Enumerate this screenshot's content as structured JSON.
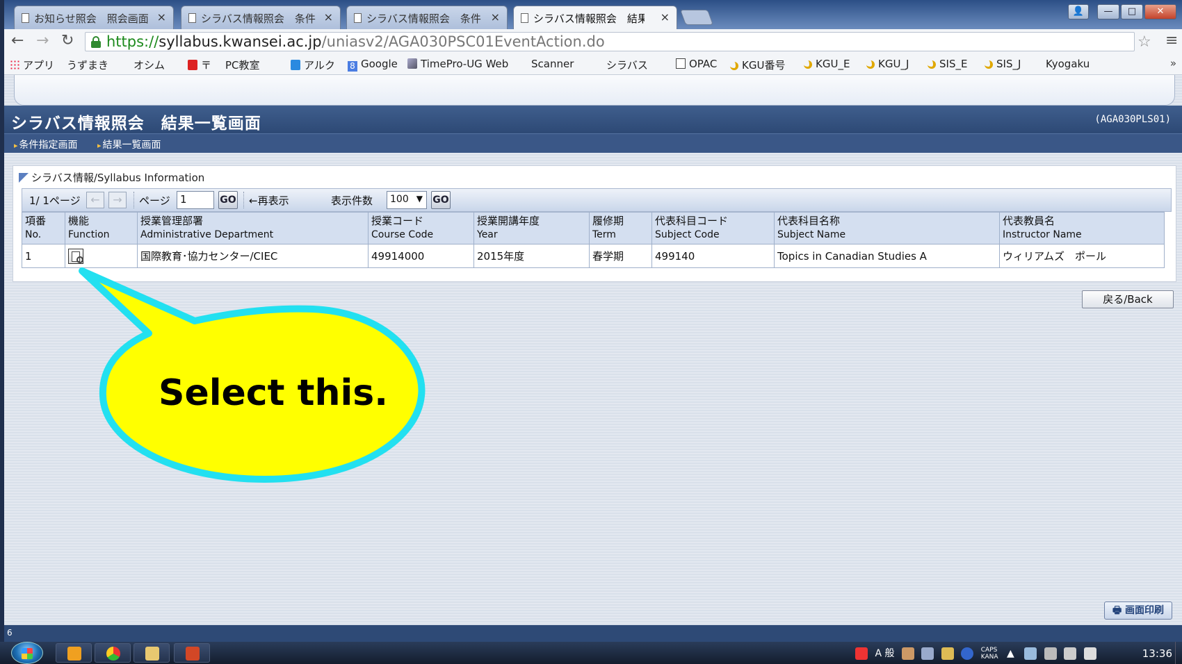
{
  "browser": {
    "tabs": [
      {
        "label": "お知らせ照会　照会画面"
      },
      {
        "label": "シラバス情報照会　条件"
      },
      {
        "label": "シラバス情報照会　条件"
      },
      {
        "label": "シラバス情報照会　結果"
      }
    ],
    "url": {
      "scheme": "https://",
      "host": "syllabus.kwansei.ac.jp",
      "path": "/uniasv2/AGA030PSC01EventAction.do"
    },
    "bookmarks": [
      {
        "label": "アプリ",
        "icon": "apps-grid-icon"
      },
      {
        "label": "うずまき",
        "icon": "page-icon"
      },
      {
        "label": "オシム",
        "icon": "page-icon"
      },
      {
        "label": "〒",
        "icon": "japan-post-icon"
      },
      {
        "label": "PC教室",
        "icon": "page-icon"
      },
      {
        "label": "アルク",
        "icon": "alc-icon"
      },
      {
        "label": "Google",
        "icon": "google-icon"
      },
      {
        "label": "TimePro-UG Web",
        "icon": "timepro-icon"
      },
      {
        "label": "Scanner",
        "icon": "page-icon"
      },
      {
        "label": "シラバス",
        "icon": "page-icon"
      },
      {
        "label": "OPAC",
        "icon": "opac-icon"
      },
      {
        "label": "KGU番号",
        "icon": "moon-icon"
      },
      {
        "label": "KGU_E",
        "icon": "moon-icon"
      },
      {
        "label": "KGU_J",
        "icon": "moon-icon"
      },
      {
        "label": "SIS_E",
        "icon": "moon-icon"
      },
      {
        "label": "SIS_J",
        "icon": "moon-icon"
      },
      {
        "label": "Kyogaku",
        "icon": "page-icon"
      }
    ],
    "more_label": "»"
  },
  "page": {
    "title": "シラバス情報照会　結果一覧画面",
    "screen_id": "(AGA030PLS01)",
    "breadcrumbs": [
      {
        "label": "条件指定画面"
      },
      {
        "label": "結果一覧画面"
      }
    ],
    "section_title": "シラバス情報/Syllabus Information",
    "pager": {
      "page_info": "1/ 1ページ",
      "page_label": "ページ",
      "page_value": "1",
      "go_label": "GO",
      "redisplay_label": "←再表示",
      "count_label": "表示件数",
      "count_value": "100",
      "go2_label": "GO"
    },
    "table": {
      "columns": [
        {
          "ja": "項番",
          "en": "No."
        },
        {
          "ja": "機能",
          "en": "Function"
        },
        {
          "ja": "授業管理部署",
          "en": "Administrative Department"
        },
        {
          "ja": "授業コード",
          "en": "Course Code"
        },
        {
          "ja": "授業開講年度",
          "en": "Year"
        },
        {
          "ja": "履修期",
          "en": "Term"
        },
        {
          "ja": "代表科目コード",
          "en": "Subject Code"
        },
        {
          "ja": "代表科目名称",
          "en": "Subject Name"
        },
        {
          "ja": "代表教員名",
          "en": "Instructor Name"
        }
      ],
      "rows": [
        {
          "no": "1",
          "function_icon": "syllabus-view-icon",
          "department": "国際教育･協力センター/CIEC",
          "course_code": "49914000",
          "year": "2015年度",
          "term": "春学期",
          "subject_code": "499140",
          "subject_name": "Topics in Canadian Studies A",
          "instructor": "ウィリアムズ　ポール"
        }
      ]
    },
    "back_label": "戻る/Back",
    "print_label": "画面印刷",
    "status_text": "6"
  },
  "callout": {
    "text": "Select this.",
    "fill_color": "#ffff00",
    "border_color": "#22e0f0"
  },
  "taskbar": {
    "tray_text": "A 般",
    "caps_label": "CAPS",
    "kana_label": "KANA",
    "clock": "13:36"
  },
  "colors": {
    "titlebar": "#2d4975",
    "table_header": "#d4dff0",
    "url_https": "#1d8a1d"
  }
}
